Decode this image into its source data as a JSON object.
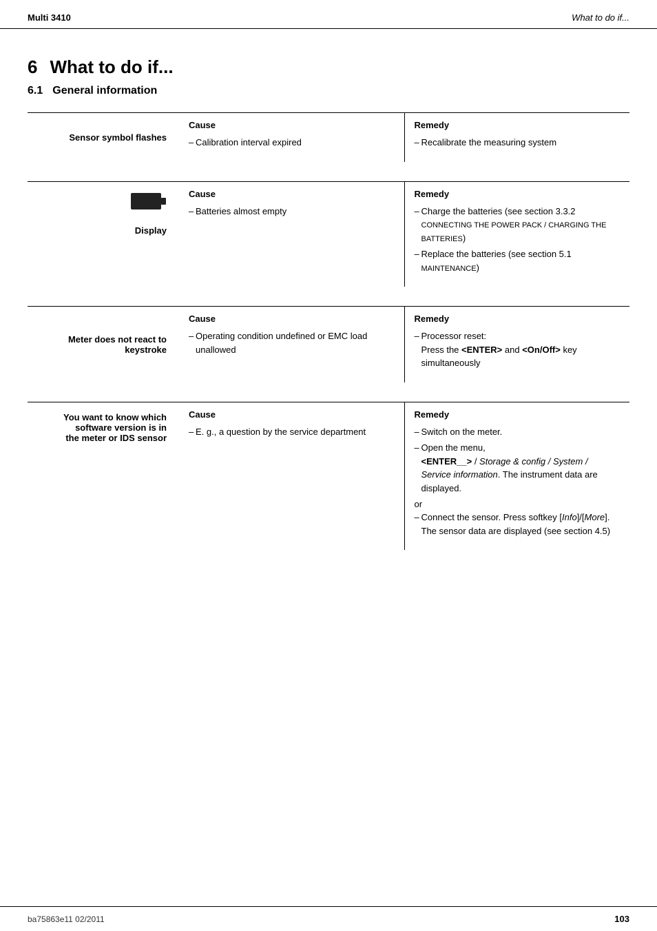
{
  "header": {
    "left": "Multi 3410",
    "right": "What to do if..."
  },
  "footer": {
    "left": "ba75863e11     02/2011",
    "right": "103"
  },
  "section": {
    "number": "6",
    "title": "What to do if...",
    "subsection_number": "6.1",
    "subsection_title": "General information"
  },
  "blocks": [
    {
      "id": "sensor-symbol",
      "left_label": "Sensor symbol flashes",
      "left_label_sub": null,
      "has_icon": false,
      "cause_header": "Cause",
      "remedy_header": "Remedy",
      "causes": [
        "Calibration interval expired"
      ],
      "remedies": [
        "Recalibrate the measuring system"
      ]
    },
    {
      "id": "display",
      "left_label": null,
      "left_label_sub": "Display",
      "has_icon": true,
      "cause_header": "Cause",
      "remedy_header": "Remedy",
      "causes": [
        "Batteries almost empty"
      ],
      "remedies": [
        "Charge the batteries (see section 3.3.2 Connecting the power pack / charging the batteries)",
        "Replace the batteries (see section 5.1 Maintenance)"
      ],
      "remedies_rich": [
        {
          "text": "Charge the batteries (see section 3.3.2 ",
          "caps": "Connecting the power pack / charging the batteries",
          "suffix": ")"
        },
        {
          "text": "Replace the batteries (see section 5.1 ",
          "caps": "Maintenance",
          "suffix": ")"
        }
      ]
    },
    {
      "id": "meter-no-react",
      "left_label": "Meter does not react to",
      "left_label_sub": "keystroke",
      "has_icon": false,
      "cause_header": "Cause",
      "remedy_header": "Remedy",
      "causes": [
        "Operating condition undefined or EMC load unallowed"
      ],
      "remedies_html": "Processor reset: Press the <strong>&lt;ENTER&gt;</strong> and <strong>&lt;On/Off&gt;</strong> key simultaneously"
    },
    {
      "id": "software-version",
      "left_label": "You want to know which software version is in",
      "left_label_sub": "the meter or IDS sensor",
      "has_icon": false,
      "cause_header": "Cause",
      "remedy_header": "Remedy",
      "causes": [
        "E. g., a question by the service department"
      ],
      "remedy_lines": [
        {
          "type": "bullet",
          "text": "Switch on the meter."
        },
        {
          "type": "bullet",
          "text": "Open the menu, <ENTER__> / Storage & config / System / Service information. The instrument data are displayed."
        },
        {
          "type": "or",
          "text": "or"
        },
        {
          "type": "bullet",
          "text": "Connect the sensor. Press softkey [Info]/[More]. The sensor data are displayed (see section 4.5)"
        }
      ]
    }
  ],
  "labels": {
    "cause": "Cause",
    "remedy": "Remedy"
  }
}
